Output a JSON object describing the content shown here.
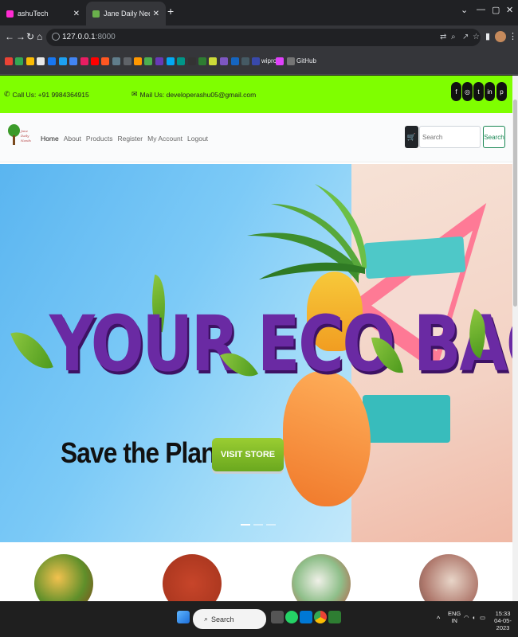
{
  "browser": {
    "tabs": [
      {
        "title": "ashuTech",
        "active": false,
        "favicon_color": "#ff2bd2"
      },
      {
        "title": "Jane Daily Needs",
        "active": true,
        "favicon_color": "#6ab04c"
      }
    ],
    "new_tab": "+",
    "window_controls": [
      "⌄",
      "—",
      "▢",
      "✕"
    ],
    "url_host": "127.0.0.1",
    "url_port": ":8000",
    "bookmarks_label_wipro": "wipro",
    "bookmarks_label_github": "GitHub"
  },
  "site": {
    "phone": "Call Us: +91 9984364915",
    "email": "Mail Us: developerashu05@gmail.com",
    "social_icons": [
      "facebook-icon",
      "instagram-icon",
      "twitter-icon",
      "linkedin-icon",
      "pinterest-icon"
    ],
    "logo_lines": [
      "Jane",
      "Daily",
      "Needs"
    ],
    "nav": [
      "Home",
      "About",
      "Products",
      "Register",
      "My Account",
      "Logout"
    ],
    "search_placeholder": "Search",
    "search_button": "Search",
    "accent_color": "#7fff00"
  },
  "hero": {
    "title": "YOUR ECO BAG",
    "subtitle": "Save the Planet",
    "cta": "VISIT STORE",
    "slides": 3,
    "active_slide": 1
  },
  "taskbar": {
    "search_label": "Search",
    "lang_top": "ENG",
    "lang_bottom": "IN",
    "time": "15:33",
    "date": "04-05-2023"
  }
}
